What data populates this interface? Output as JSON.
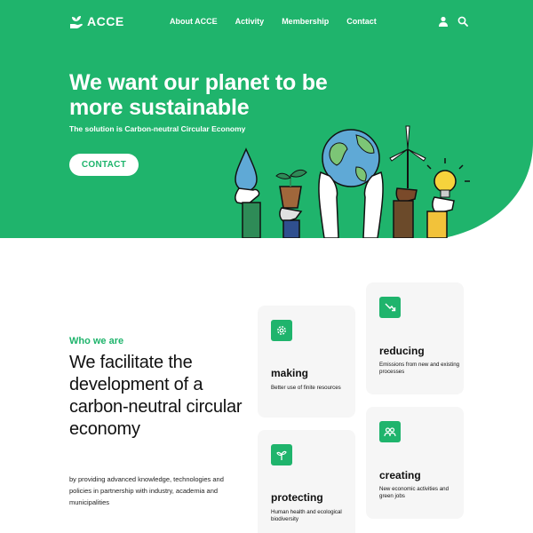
{
  "brand": {
    "name": "ACCE",
    "logo_icon": "hand-sprout-icon",
    "accent": "#1fb46c"
  },
  "nav": {
    "links": [
      "About ACCE",
      "Activity",
      "Membership",
      "Contact"
    ],
    "icons": [
      "user-icon",
      "search-icon"
    ]
  },
  "hero": {
    "title": "We want our planet to be more sustainable",
    "subtitle": "The solution is Carbon-neutral Circular Economy",
    "cta": "CONTACT",
    "illustration": "hands-holding-water-drop-plant-earth-wind-turbine-lightbulb"
  },
  "about": {
    "eyebrow": "Who we are",
    "heading": "We facilitate the development of a carbon-neutral circular economy",
    "description": "by providing advanced knowledge, technologies and policies in partnership with industry, academia and municipalities"
  },
  "cards": [
    {
      "id": "making",
      "title": "making",
      "desc": "Better use of finite resources",
      "icon": "gear-icon"
    },
    {
      "id": "reducing",
      "title": "reducing",
      "desc": "Emissions from new and existing processes",
      "icon": "trend-down-icon"
    },
    {
      "id": "protecting",
      "title": "protecting",
      "desc": "Human health and ecological biodiversity",
      "icon": "sprout-icon"
    },
    {
      "id": "creating",
      "title": "creating",
      "desc": "New economic activities and green jobs",
      "icon": "people-icon"
    }
  ]
}
